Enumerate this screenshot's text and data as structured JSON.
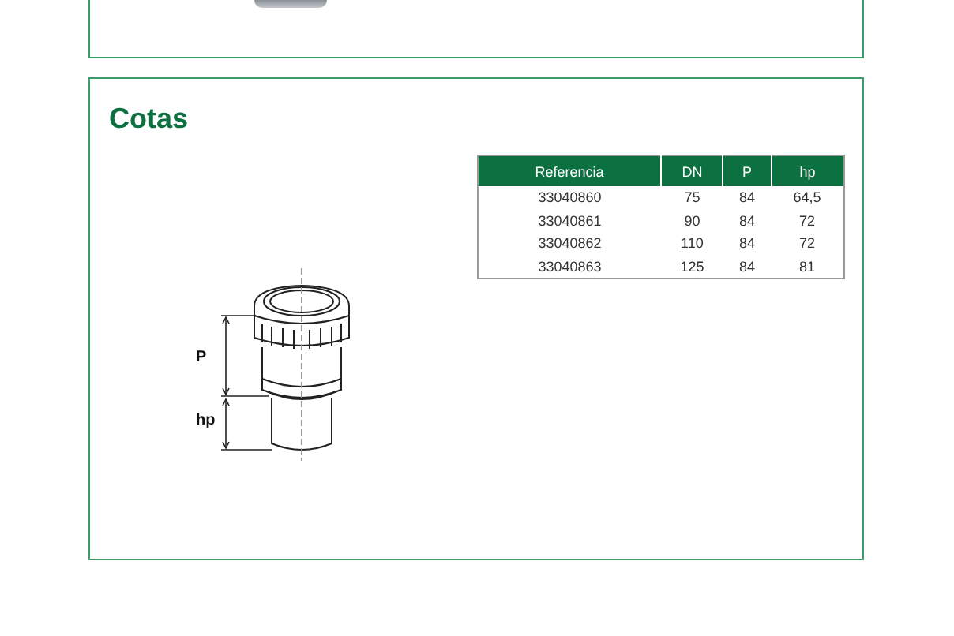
{
  "cotas": {
    "title": "Cotas",
    "drawing": {
      "labels": [
        "P",
        "hp"
      ]
    },
    "table": {
      "columns": [
        "Referencia",
        "DN",
        "P",
        "hp"
      ],
      "rows": [
        [
          "33040860",
          "75",
          "84",
          "64,5"
        ],
        [
          "33040861",
          "90",
          "84",
          "72"
        ],
        [
          "33040862",
          "110",
          "84",
          "72"
        ],
        [
          "33040863",
          "125",
          "84",
          "81"
        ]
      ]
    }
  }
}
